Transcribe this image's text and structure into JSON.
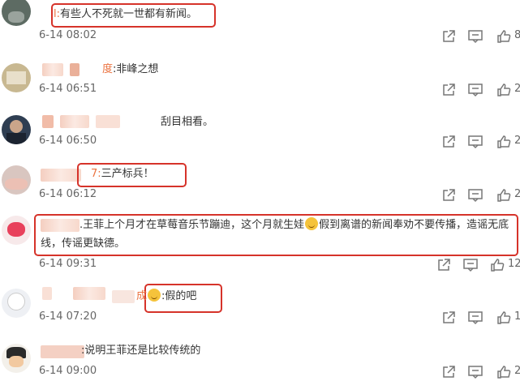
{
  "comments": [
    {
      "text": "有些人不死就一世都有新闻。",
      "prefix": "l:",
      "time": "6-14 08:02",
      "likes": "8"
    },
    {
      "name_tail": "度",
      "text": ":非峰之想",
      "time": "6-14 06:51",
      "likes": "2"
    },
    {
      "text": "刮目相看。",
      "time": "6-14 06:50",
      "likes": "2"
    },
    {
      "prefix": "7:",
      "text": "三产标兵！",
      "time": "6-14 06:12",
      "likes": "2"
    },
    {
      "text_line1_a": ".王菲上个月才在草莓音乐节蹦迪，这个月就生娃",
      "text_line1_b": "假到离谱的新闻奉劝不要传播，造谣无底",
      "text_line2": "线，传谣更缺德。",
      "time": "6-14 09:31",
      "likes": "12"
    },
    {
      "name_tail": "成",
      "text": ":假的吧",
      "time": "6-14 07:20",
      "likes": "1"
    },
    {
      "text": ":说明王菲还是比较传统的",
      "time": "6-14 09:00",
      "likes": "2"
    }
  ]
}
